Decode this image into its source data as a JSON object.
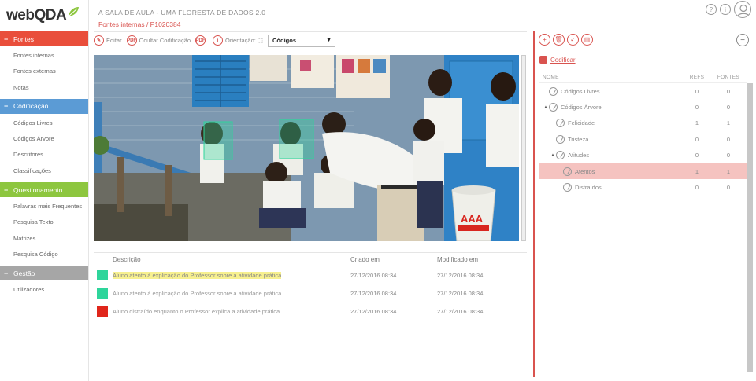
{
  "brand": {
    "logo_text": "webQDA"
  },
  "header": {
    "project_title": "A SALA DE AULA - UMA FLORESTA DE DADOS 2.0",
    "breadcrumb": "Fontes internas / P1020384",
    "help_label": "?",
    "info_label": "i"
  },
  "sidebar": {
    "sections": [
      {
        "title": "Fontes",
        "color": "#e94e3b",
        "items": [
          "Fontes internas",
          "Fontes externas",
          "Notas"
        ]
      },
      {
        "title": "Codificação",
        "color": "#5b9bd5",
        "items": [
          "Códigos Livres",
          "Códigos Árvore",
          "Descritores",
          "Classificações"
        ]
      },
      {
        "title": "Questionamento",
        "color": "#8dc63f",
        "items": [
          "Palavras mais Frequentes",
          "Pesquisa Texto",
          "Matrizes",
          "Pesquisa Código"
        ]
      },
      {
        "title": "Gestão",
        "color": "#a6a6a6",
        "items": [
          "Utilizadores"
        ]
      }
    ]
  },
  "toolbar": {
    "buttons": [
      {
        "icon": "edit-icon",
        "glyph": "✎",
        "label": "Editar"
      },
      {
        "icon": "ocultar-icon",
        "glyph": "PDF",
        "label": "Ocultar Codificação"
      },
      {
        "icon": "export-icon",
        "glyph": "PDF",
        "label": ""
      },
      {
        "icon": "info-icon",
        "glyph": "i",
        "label": "Orientação: ⬚"
      }
    ],
    "select_value": "Códigos"
  },
  "table": {
    "columns": [
      "Descrição",
      "Criado em",
      "Modificado em"
    ],
    "rows": [
      {
        "color": "#2ed59b",
        "description": "Aluno atento à explicação do Professor sobre a atividade prática",
        "created": "27/12/2016 08:34",
        "modified": "27/12/2016 08:34",
        "highlighted": true
      },
      {
        "color": "#2ed59b",
        "description": "Aluno atento à explicação do Professor sobre a atividade prática",
        "created": "27/12/2016 08:34",
        "modified": "27/12/2016 08:34",
        "highlighted": false
      },
      {
        "color": "#e0261b",
        "description": "Aluno distraído enquanto o Professor explica a atividade prática",
        "created": "27/12/2016 08:34",
        "modified": "27/12/2016 08:34",
        "highlighted": false
      }
    ]
  },
  "right_panel": {
    "codify_label": "Codificar",
    "columns": [
      "NOME",
      "REFS",
      "FONTES"
    ],
    "tree": [
      {
        "name": "Códigos Livres",
        "refs": "0",
        "sources": "0",
        "level": 0,
        "toggle": "",
        "selected": false
      },
      {
        "name": "Códigos Árvore",
        "refs": "0",
        "sources": "0",
        "level": 0,
        "toggle": "▲",
        "selected": false
      },
      {
        "name": "Felicidade",
        "refs": "1",
        "sources": "1",
        "level": 1,
        "toggle": "",
        "selected": false
      },
      {
        "name": "Tristeza",
        "refs": "0",
        "sources": "0",
        "level": 1,
        "toggle": "",
        "selected": false
      },
      {
        "name": "Atitudes",
        "refs": "0",
        "sources": "0",
        "level": 1,
        "toggle": "▲",
        "selected": false
      },
      {
        "name": "Atentos",
        "refs": "1",
        "sources": "1",
        "level": 2,
        "toggle": "",
        "selected": true
      },
      {
        "name": "Distraídos",
        "refs": "0",
        "sources": "0",
        "level": 2,
        "toggle": "",
        "selected": false
      }
    ]
  }
}
